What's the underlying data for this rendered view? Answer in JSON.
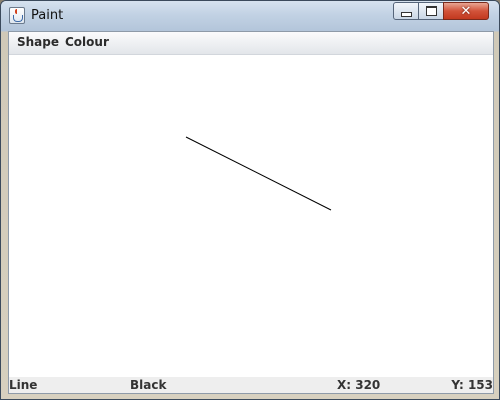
{
  "window": {
    "title": "Paint",
    "icon": "java-cup-icon",
    "controls": [
      "minimize",
      "maximize",
      "close"
    ]
  },
  "menubar": {
    "items": [
      "Shape",
      "Colour"
    ]
  },
  "canvas": {
    "background": "#ffffff",
    "stroke_color": "#000000"
  },
  "statusbar": {
    "shape": "Line",
    "colour": "Black",
    "x": "X: 320",
    "y": "Y: 153"
  }
}
